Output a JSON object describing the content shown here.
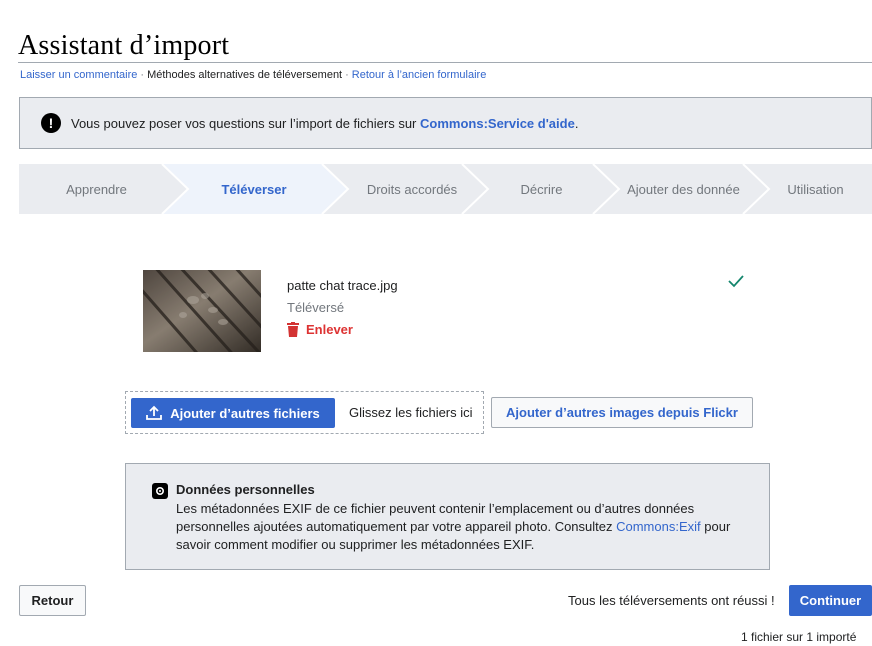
{
  "page": {
    "title": "Assistant d’import"
  },
  "links": [
    {
      "label": "Laisser un commentaire"
    },
    {
      "label": "Méthodes alternatives de téléversement"
    },
    {
      "label": "Retour à l’ancien formulaire"
    }
  ],
  "links_separator": "·",
  "notice": {
    "icon": "!",
    "text_before": "Vous pouvez poser vos questions sur l’import de fichiers sur ",
    "link": "Commons:Service d'aide",
    "text_after": "."
  },
  "steps": [
    {
      "label": "Apprendre",
      "active": false
    },
    {
      "label": "Téléverser",
      "active": true
    },
    {
      "label": "Droits accordés",
      "active": false
    },
    {
      "label": "Décrire",
      "active": false
    },
    {
      "label": "Ajouter des donnée",
      "active": false
    },
    {
      "label": "Utilisation",
      "active": false
    }
  ],
  "file": {
    "name": "patte chat trace.jpg",
    "status": "Téléversé",
    "remove_label": "Enlever",
    "status_icon": "checkmark-icon"
  },
  "upload": {
    "add_files_label": "Ajouter d’autres fichiers",
    "drop_text": "Glissez les fichiers ici",
    "flickr_label": "Ajouter d’autres images depuis Flickr"
  },
  "privacy": {
    "title": "Données personnelles",
    "body_before": "Les métadonnées EXIF de ce fichier peuvent contenir l’emplacement ou d’autres données personnelles ajoutées automatiquement par votre appareil photo. Consultez ",
    "link": "Commons:Exif",
    "body_after": " pour savoir comment modifier ou supprimer les métadonnées EXIF."
  },
  "footer": {
    "back_label": "Retour",
    "success_text": "Tous les téléversements ont réussi !",
    "continue_label": "Continuer",
    "count_text": "1 fichier sur 1 importé"
  },
  "colors": {
    "link": "#3366cc",
    "primary": "#3366cc",
    "destructive": "#d33333",
    "success": "#14866d",
    "panel": "#eaecf0"
  }
}
